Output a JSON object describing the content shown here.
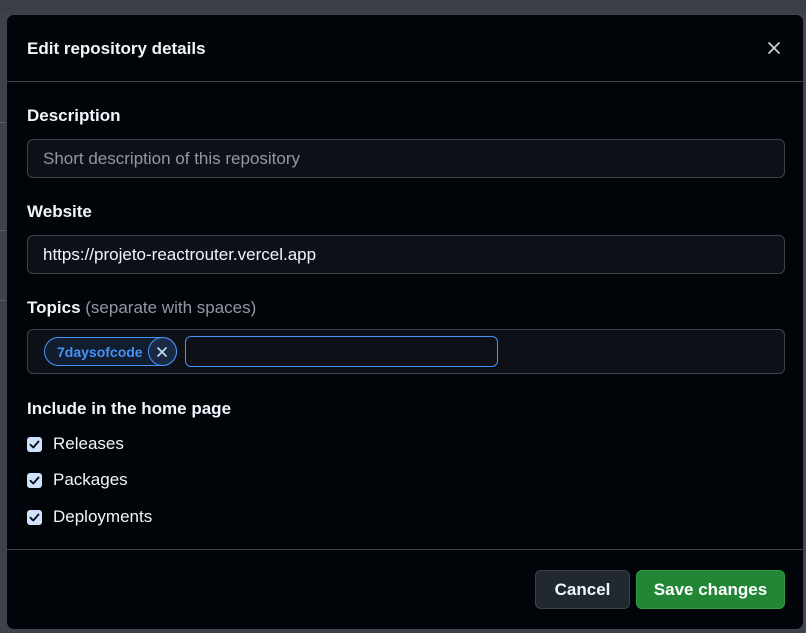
{
  "dialog": {
    "title": "Edit repository details",
    "close_icon": "close-icon"
  },
  "description": {
    "label": "Description",
    "value": "",
    "placeholder": "Short description of this repository"
  },
  "website": {
    "label": "Website",
    "value": "https://projeto-reactrouter.vercel.app"
  },
  "topics": {
    "label": "Topics",
    "hint": "(separate with spaces)",
    "tags": [
      {
        "label": "7daysofcode",
        "remove_icon": "x-icon"
      }
    ],
    "input_value": ""
  },
  "home_page": {
    "label": "Include in the home page",
    "options": [
      {
        "label": "Releases",
        "checked": true
      },
      {
        "label": "Packages",
        "checked": true
      },
      {
        "label": "Deployments",
        "checked": true
      }
    ]
  },
  "footer": {
    "cancel_label": "Cancel",
    "save_label": "Save changes"
  },
  "colors": {
    "dialog_bg": "#010409",
    "input_bg": "#0d1117",
    "border": "#3d444d",
    "accent": "#4493f8",
    "primary_button": "#238636",
    "checkbox": "#cfe3fd"
  }
}
